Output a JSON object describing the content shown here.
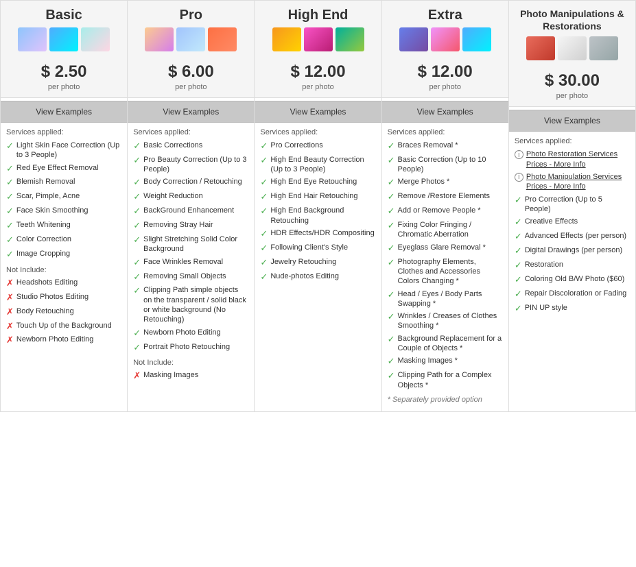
{
  "columns": [
    {
      "id": "basic",
      "title": "Basic",
      "price": "$ 2.50",
      "per_photo": "per photo",
      "view_examples": "View Examples",
      "services_label": "Services applied:",
      "included": [
        "Light Skin Face Correction (Up to 3 People)",
        "Red Eye Effect Removal",
        "Blemish Removal",
        "Scar, Pimple, Acne",
        "Face Skin Smoothing",
        "Teeth Whitening",
        "Color Correction",
        "Image Cropping"
      ],
      "not_include_label": "Not Include:",
      "excluded": [
        "Headshots Editing",
        "Studio Photos Editing",
        "Body Retouching",
        "Touch Up of the Background",
        "Newborn Photo Editing"
      ]
    },
    {
      "id": "pro",
      "title": "Pro",
      "price": "$ 6.00",
      "per_photo": "per photo",
      "view_examples": "View Examples",
      "services_label": "Services applied:",
      "included": [
        "Basic Corrections",
        "Pro Beauty Correction (Up to 3 People)",
        "Body Correction / Retouching",
        "Weight Reduction",
        "BackGround Enhancement",
        "Removing Stray Hair",
        "Slight Stretching Solid Color Background",
        "Face Wrinkles Removal",
        "Removing Small Objects",
        "Clipping Path simple objects on the transparent / solid black or white background (No Retouching)",
        "Newborn Photo Editing",
        "Portrait Photo Retouching"
      ],
      "not_include_label": "Not Include:",
      "excluded": [
        "Masking Images"
      ]
    },
    {
      "id": "high-end",
      "title": "High End",
      "price": "$ 12.00",
      "per_photo": "per photo",
      "view_examples": "View Examples",
      "services_label": "Services applied:",
      "included": [
        "Pro Corrections",
        "High End Beauty Correction (Up to 3 People)",
        "High End Eye Retouching",
        "High End Hair Retouching",
        "High End Background Retouching",
        "HDR Effects/HDR Compositing",
        "Following Client's Style",
        "Jewelry Retouching",
        "Nude-photos Editing"
      ],
      "not_include_label": "",
      "excluded": []
    },
    {
      "id": "extra",
      "title": "Extra",
      "price": "$ 12.00",
      "per_photo": "per photo",
      "view_examples": "View Examples",
      "services_label": "Services applied:",
      "included": [
        "Braces Removal *",
        "Basic Correction (Up to 10 People)",
        "Merge Photos *",
        "Remove /Restore Elements",
        "Add or Remove People *",
        "Fixing Color Fringing / Chromatic Aberration",
        "Eyeglass Glare Removal *",
        "Photography Elements, Clothes and Accessories Colors Changing *",
        "Head / Eyes / Body Parts Swapping *",
        "Wrinkles / Creases of Clothes Smoothing *",
        "Background Replacement for a Couple of Objects *",
        "Masking Images *",
        "Clipping Path for a Complex Objects *"
      ],
      "not_include_label": "",
      "excluded": [],
      "footer_note": "* Separately provided option"
    },
    {
      "id": "manip",
      "title": "Photo Manipulations & Restorations",
      "price": "$ 30.00",
      "per_photo": "per photo",
      "view_examples": "View Examples",
      "services_label": "Services applied:",
      "info_items": [
        {
          "text": "Photo Restoration Services",
          "link": "Photo Restoration Services",
          "suffix": "Prices - More Info"
        },
        {
          "text": "Photo Manipulation Services",
          "link": "Photo Manipulation Services",
          "suffix": "Prices - More Info"
        }
      ],
      "included": [
        "Pro Correction (Up to 5 People)",
        "Creative Effects",
        "Advanced Effects (per person)",
        "Digital Drawings (per person)",
        "Restoration",
        "Coloring Old B/W Photo ($60)",
        "Repair Discoloration or Fading",
        "PIN UP style"
      ],
      "not_include_label": "",
      "excluded": []
    }
  ],
  "icons": {
    "check": "✓",
    "cross": "✗",
    "info": "i"
  }
}
